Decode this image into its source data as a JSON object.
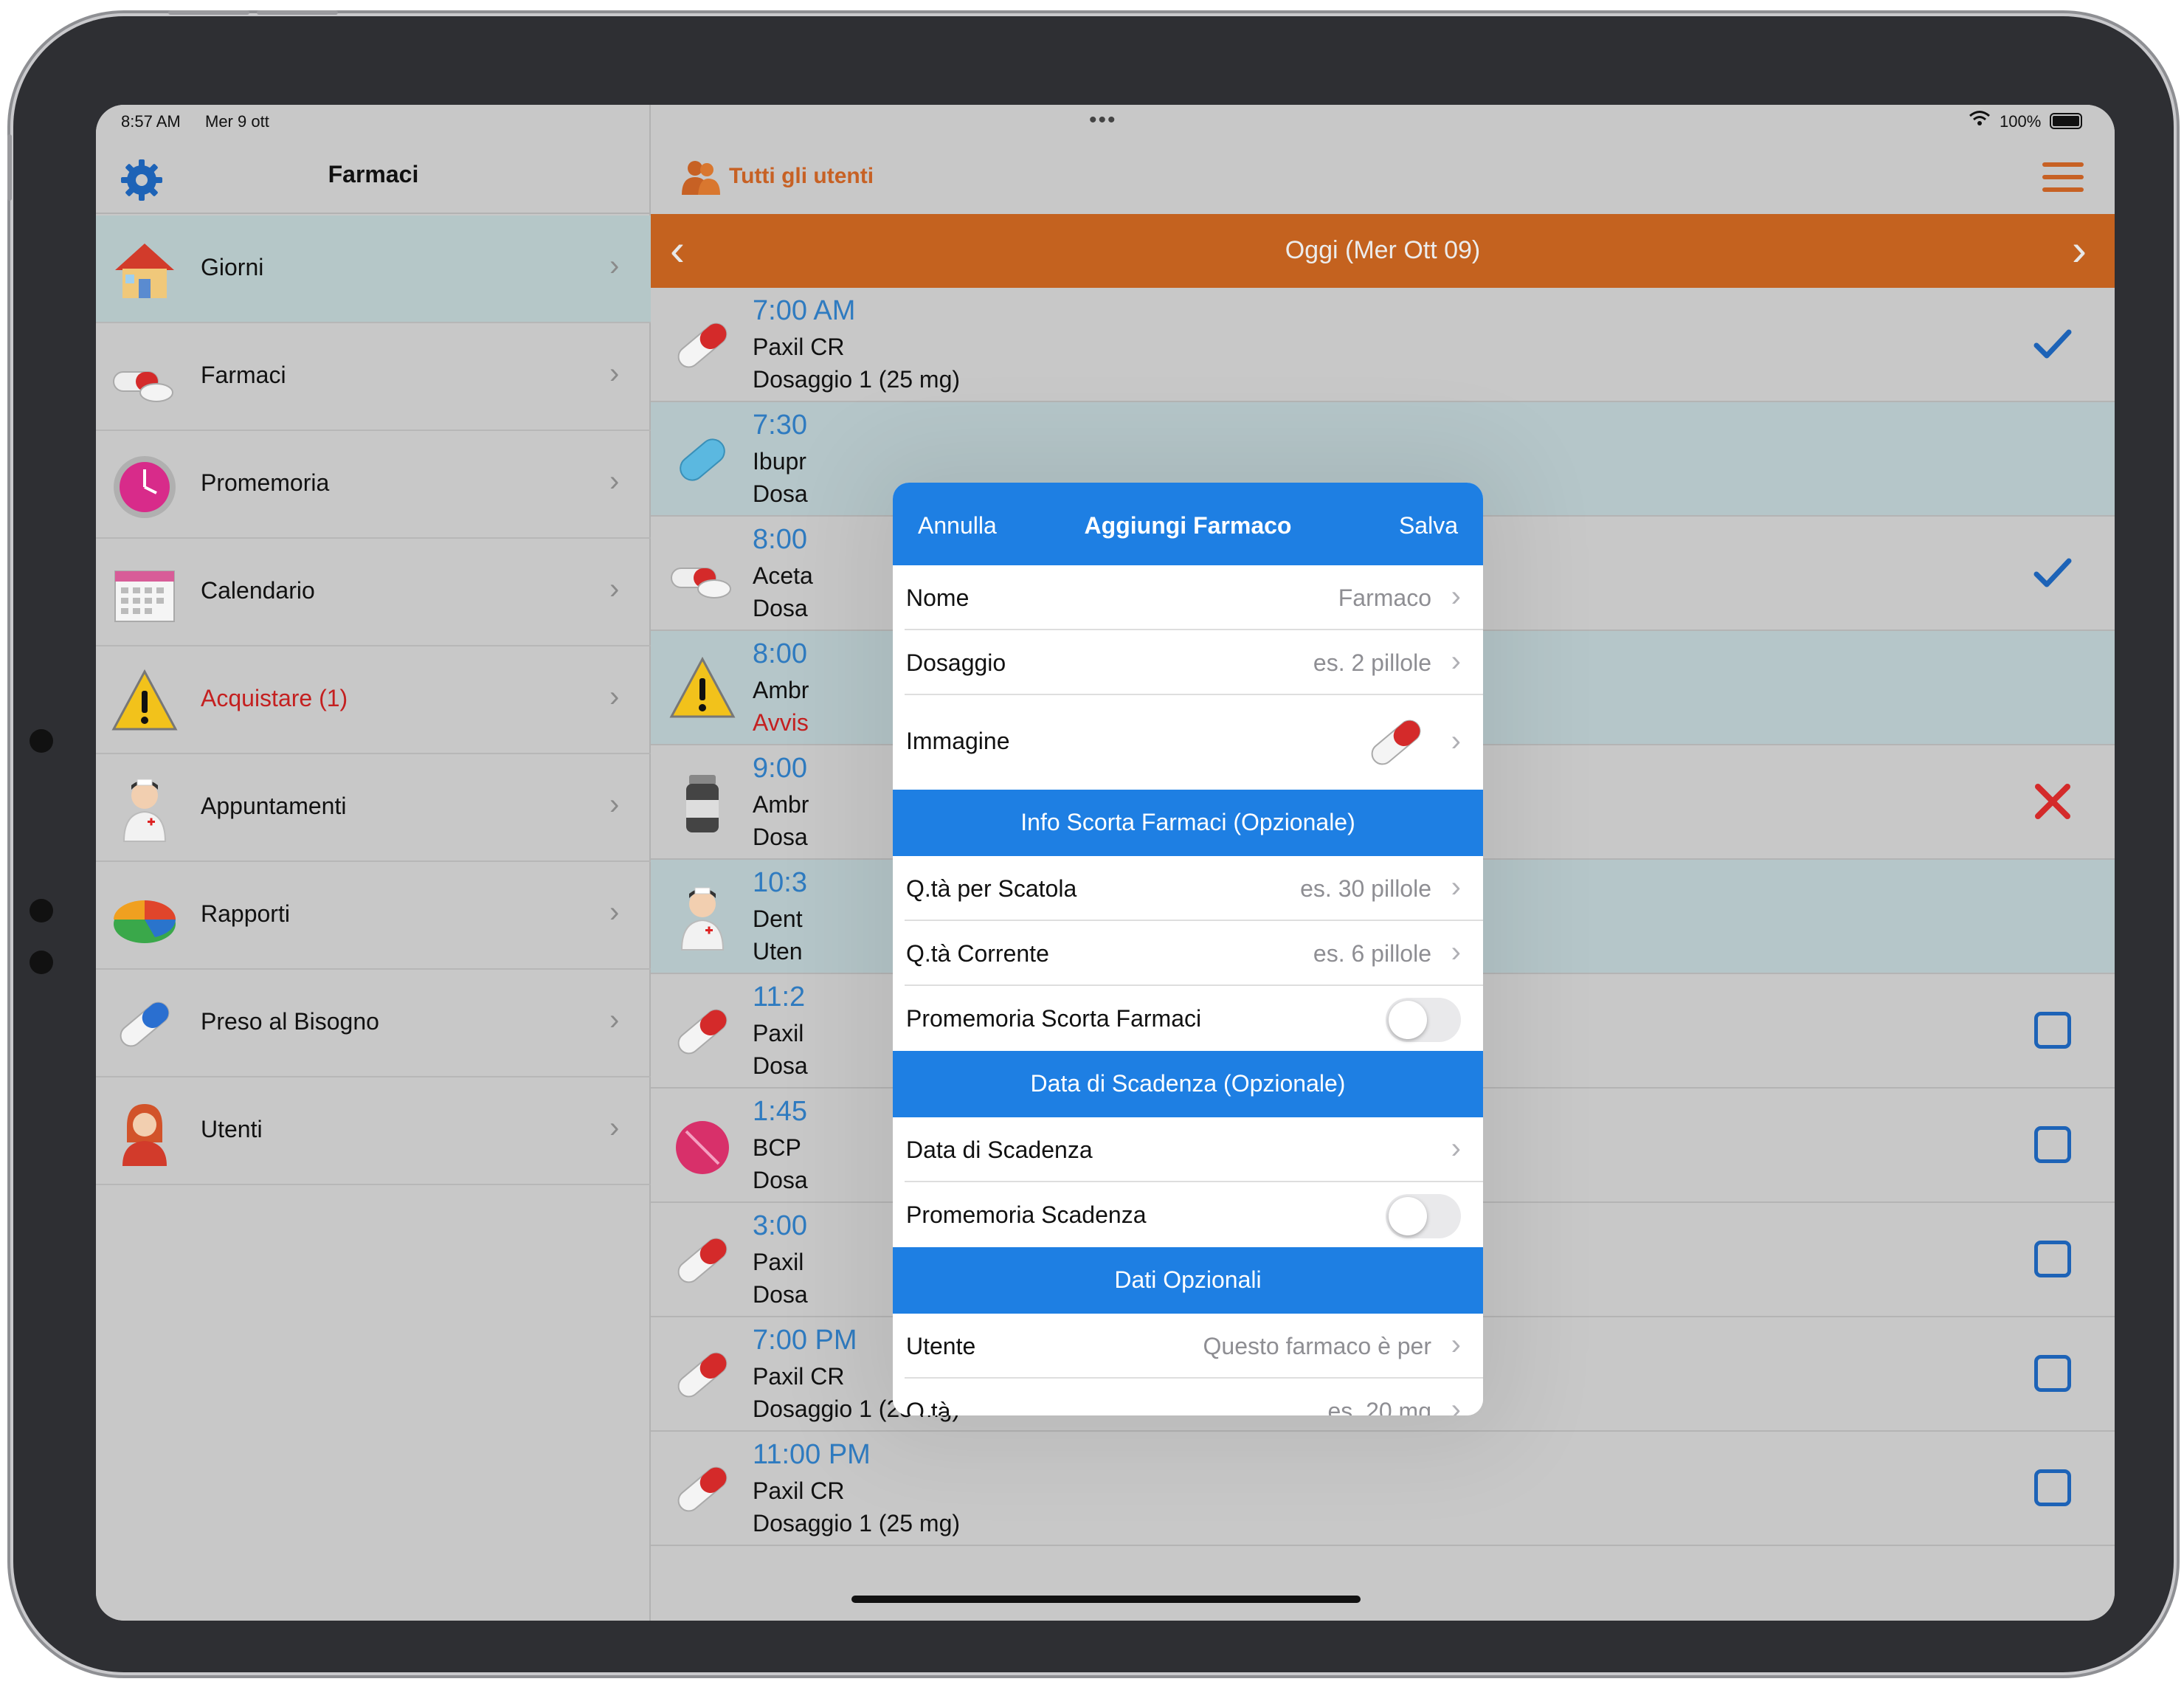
{
  "status_bar": {
    "time": "8:57 AM",
    "date": "Mer 9 ott",
    "dots": "•••",
    "battery": "100%"
  },
  "sidebar": {
    "title": "Farmaci",
    "items": [
      {
        "label": "Giorni",
        "icon": "house-icon"
      },
      {
        "label": "Farmaci",
        "icon": "pills-icon"
      },
      {
        "label": "Promemoria",
        "icon": "clock-icon"
      },
      {
        "label": "Calendario",
        "icon": "calendar-icon"
      },
      {
        "label": "Acquistare (1)",
        "icon": "warning-icon"
      },
      {
        "label": "Appuntamenti",
        "icon": "nurse-icon"
      },
      {
        "label": "Rapporti",
        "icon": "pie-chart-icon"
      },
      {
        "label": "Preso al Bisogno",
        "icon": "capsule-icon"
      },
      {
        "label": "Utenti",
        "icon": "user-icon"
      }
    ]
  },
  "header": {
    "users_label": "Tutti gli utenti",
    "day_title": "Oggi (Mer Ott 09)"
  },
  "meds": [
    {
      "time": "7:00 AM",
      "name": "Paxil CR",
      "dose": "Dosaggio 1 (25 mg)",
      "status": "taken"
    },
    {
      "time": "7:30",
      "name": "Ibupr",
      "dose": "Dosa",
      "status": "none"
    },
    {
      "time": "8:00",
      "name": "Aceta",
      "dose": "Dosa",
      "status": "taken"
    },
    {
      "time": "8:00",
      "name": "Ambr",
      "dose": "Avvis",
      "status": "none"
    },
    {
      "time": "9:00",
      "name": "Ambr",
      "dose": "Dosa",
      "status": "skipped"
    },
    {
      "time": "10:3",
      "name": "Dent",
      "dose": "Uten",
      "status": "none"
    },
    {
      "time": "11:2",
      "name": "Paxil",
      "dose": "Dosa",
      "status": "pending"
    },
    {
      "time": "1:45",
      "name": "BCP",
      "dose": "Dosa",
      "status": "pending"
    },
    {
      "time": "3:00",
      "name": "Paxil",
      "dose": "Dosa",
      "status": "pending"
    },
    {
      "time": "7:00 PM",
      "name": "Paxil CR",
      "dose": "Dosaggio 1 (25 mg)",
      "status": "pending"
    },
    {
      "time": "11:00 PM",
      "name": "Paxil CR",
      "dose": "Dosaggio 1 (25 mg)",
      "status": "pending"
    }
  ],
  "modal": {
    "cancel": "Annulla",
    "title": "Aggiungi Farmaco",
    "save": "Salva",
    "nome": {
      "label": "Nome",
      "value": "Farmaco"
    },
    "dosaggio": {
      "label": "Dosaggio",
      "value": "es. 2 pillole"
    },
    "immagine": {
      "label": "Immagine"
    },
    "section_scorta": "Info Scorta Farmaci (Opzionale)",
    "qta_scatola": {
      "label": "Q.tà per Scatola",
      "value": "es. 30 pillole"
    },
    "qta_corrente": {
      "label": "Q.tà Corrente",
      "value": "es. 6 pillole"
    },
    "promemoria_scorta": {
      "label": "Promemoria Scorta Farmaci",
      "on": false
    },
    "section_scadenza": "Data di Scadenza (Opzionale)",
    "data_scadenza": {
      "label": "Data di Scadenza"
    },
    "promemoria_scadenza": {
      "label": "Promemoria Scadenza",
      "on": false
    },
    "section_opzionali": "Dati Opzionali",
    "utente": {
      "label": "Utente",
      "value": "Questo farmaco è per"
    },
    "qta": {
      "label": "Q.tà",
      "value": "es. 20 mg"
    }
  },
  "colors": {
    "accent_orange": "#c4621f",
    "modal_blue": "#1e7fe3",
    "time_blue": "#2f7bc0",
    "alert_red": "#c42020"
  }
}
